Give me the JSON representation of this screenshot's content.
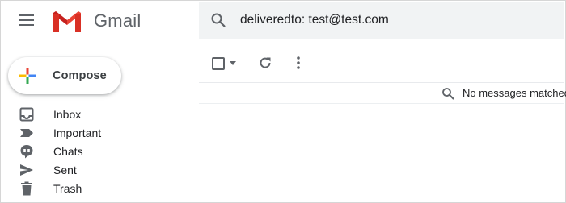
{
  "header": {
    "menu_icon": "hamburger-menu-icon",
    "logo_icon": "gmail-m-logo",
    "app_name": "Gmail",
    "colors": {
      "red": "#EA4335",
      "dark_red": "#C5221F",
      "grey": "#5f6368"
    }
  },
  "search": {
    "icon": "search-icon",
    "query": "deliveredto: test@test.com",
    "background": "#f1f3f4"
  },
  "compose": {
    "label": "Compose",
    "icon": "compose-plus-icon",
    "plus_colors": [
      "#EA4335",
      "#FBBC04",
      "#34A853",
      "#4285F4"
    ]
  },
  "sidebar": {
    "items": [
      {
        "label": "Inbox",
        "icon": "inbox-icon"
      },
      {
        "label": "Important",
        "icon": "important-icon"
      },
      {
        "label": "Chats",
        "icon": "chats-icon"
      },
      {
        "label": "Sent",
        "icon": "sent-icon"
      },
      {
        "label": "Trash",
        "icon": "trash-icon"
      }
    ]
  },
  "toolbar": {
    "select_icon": "checkbox-icon",
    "select_dropdown_icon": "caret-down-icon",
    "refresh_icon": "refresh-icon",
    "more_icon": "more-vert-icon"
  },
  "results": {
    "icon": "search-icon",
    "message": "No messages matched"
  }
}
